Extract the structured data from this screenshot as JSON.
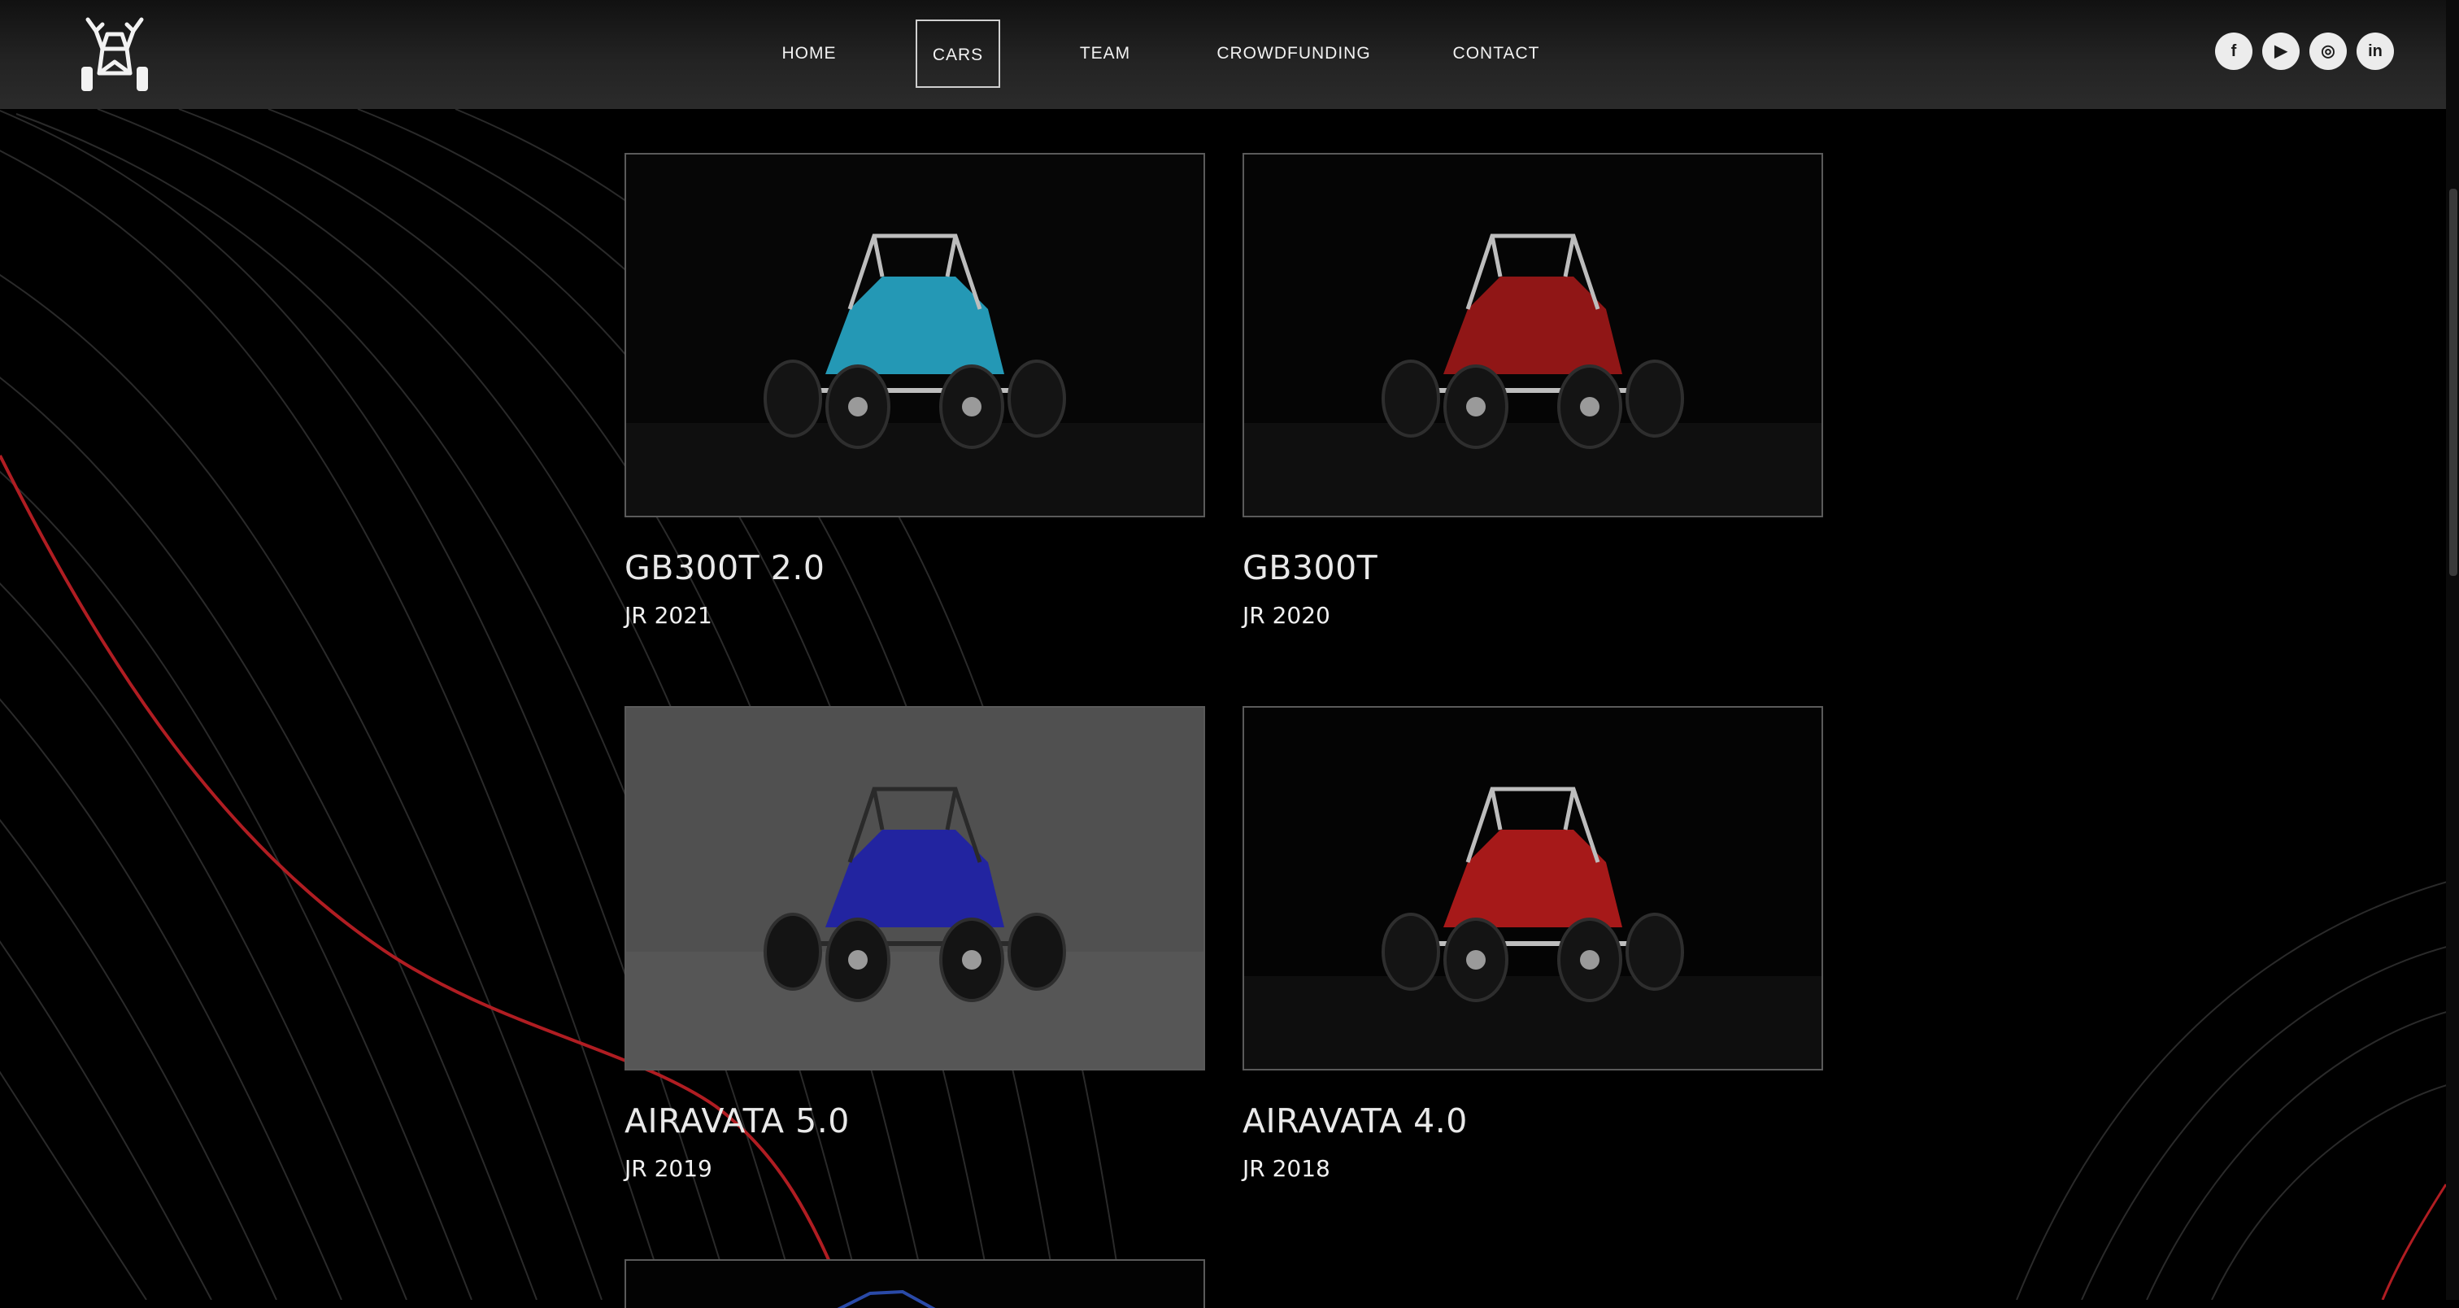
{
  "brand": {
    "logo_icon": "buggy-logo-icon",
    "accent": "#c8202a"
  },
  "nav": {
    "items": [
      {
        "label": "HOME",
        "active": false
      },
      {
        "label": "CARS",
        "active": true
      },
      {
        "label": "TEAM",
        "active": false
      },
      {
        "label": "CROWDFUNDING",
        "active": false
      },
      {
        "label": "CONTACT",
        "active": false
      }
    ]
  },
  "socials": [
    {
      "icon": "facebook-icon",
      "glyph": "f"
    },
    {
      "icon": "youtube-icon",
      "glyph": "▶"
    },
    {
      "icon": "instagram-icon",
      "glyph": "◎"
    },
    {
      "icon": "linkedin-icon",
      "glyph": "in"
    }
  ],
  "cars": [
    {
      "name": "GB300T 2.0",
      "year": "JR 2021",
      "livery": "#28a9c9",
      "bg": "#060606"
    },
    {
      "name": "GB300T",
      "year": "JR 2020",
      "livery": "#a01818",
      "bg": "#050505"
    },
    {
      "name": "AIRAVATA 5.0",
      "year": "JR 2019",
      "livery": "#1d1fa8",
      "bg": "#505050"
    },
    {
      "name": "AIRAVATA 4.0",
      "year": "JR 2018",
      "livery": "#b81c1c",
      "bg": "#040404"
    }
  ]
}
